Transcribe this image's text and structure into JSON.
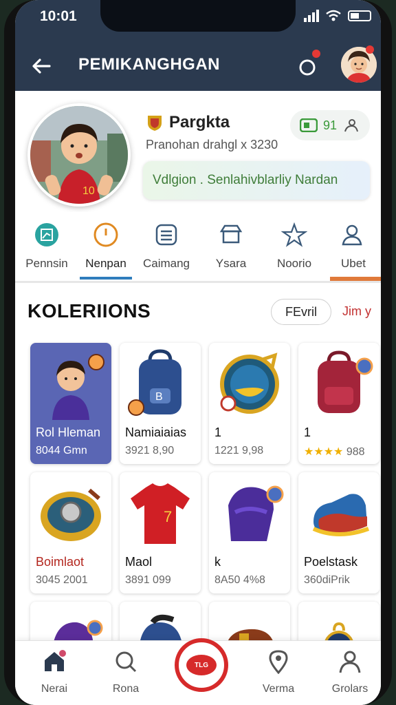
{
  "status": {
    "time": "10:01"
  },
  "appbar": {
    "title": "PEMIKANGHGAN"
  },
  "profile": {
    "name": "Pargkta",
    "subtitle": "Pranohan drahgl x 3230",
    "pill_value": "91",
    "banner": "Vdlgion . Senlahivblarliy Nardan"
  },
  "tabs": [
    {
      "label": "Pennsin"
    },
    {
      "label": "Nenpan"
    },
    {
      "label": "Caimang"
    },
    {
      "label": "Ysara"
    },
    {
      "label": "Noorio"
    },
    {
      "label": "Ubet"
    }
  ],
  "collections": {
    "title": "KOLERIIONS",
    "filter_label": "FEvril",
    "sort_label": "Jim y",
    "items": [
      {
        "name": "Rol Hleman",
        "price": "8044 Gmn"
      },
      {
        "name": "Namiaiaias",
        "price": "3921 8,90"
      },
      {
        "name": "1",
        "price": "1221 9,98"
      },
      {
        "name": "1",
        "stars": "★★★★",
        "price": "988"
      },
      {
        "name": "Boimlaot",
        "price": "3045 2001"
      },
      {
        "name": "Maol",
        "price": "3891 099"
      },
      {
        "name": "k",
        "price": "8A50 4%8"
      },
      {
        "name": "Poelstask",
        "price": "360diPrik"
      }
    ]
  },
  "fab_label": "TLG",
  "bottomnav": [
    {
      "label": "Nerai"
    },
    {
      "label": "Rona"
    },
    {
      "label": "Verma"
    },
    {
      "label": "Grolars"
    }
  ]
}
